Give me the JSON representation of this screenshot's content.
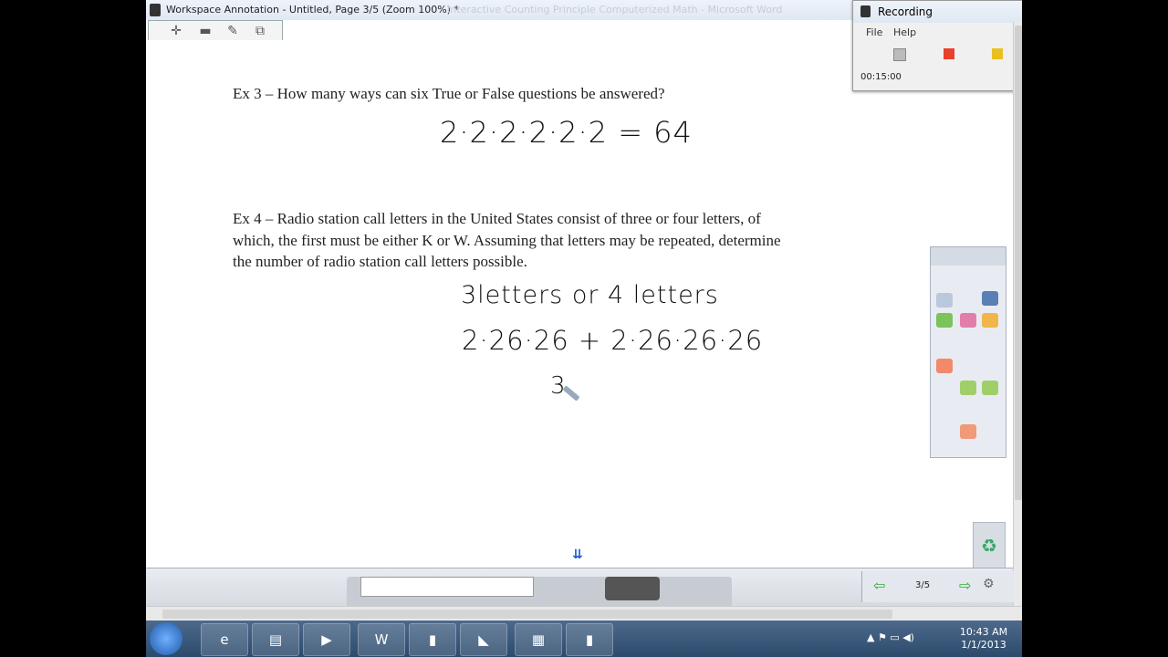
{
  "window": {
    "title": "Workspace Annotation - Untitled, Page 3/5  (Zoom 100%) *",
    "ghost_title": "Interactive  Counting Principle  Computerized  Math  -  Microsoft Word"
  },
  "toolbar": {
    "add_icon": "plus-icon",
    "remove_icon": "minus-icon",
    "edit_icon": "edit-icon",
    "copy_icon": "copy-icon"
  },
  "content": {
    "ex3_text": "Ex 3 – How many ways can six True or False questions be answered?",
    "ex3_hand": "2·2·2·2·2·2 = 64",
    "ex4_line1": "Ex 4 – Radio station call letters in the United States consist of three or four letters, of",
    "ex4_line2": "which, the first must be either K or W.  Assuming that letters may be repeated, determine",
    "ex4_line3": "the number of radio station call letters possible.",
    "hand_line1": "3letters  or  4 letters",
    "hand_line2": "2·26·26  +  2·26·26·26",
    "hand_line3": "3"
  },
  "recording": {
    "title": "Recording",
    "menu_file": "File",
    "menu_help": "Help",
    "time": "00:15:00",
    "stop_color": "#e8402a",
    "pause_color": "#e8c020"
  },
  "pagenav": {
    "page_indicator": "3/5"
  },
  "taskbar": {
    "time": "10:43 AM",
    "date": "1/1/2013",
    "word_label": "W"
  }
}
